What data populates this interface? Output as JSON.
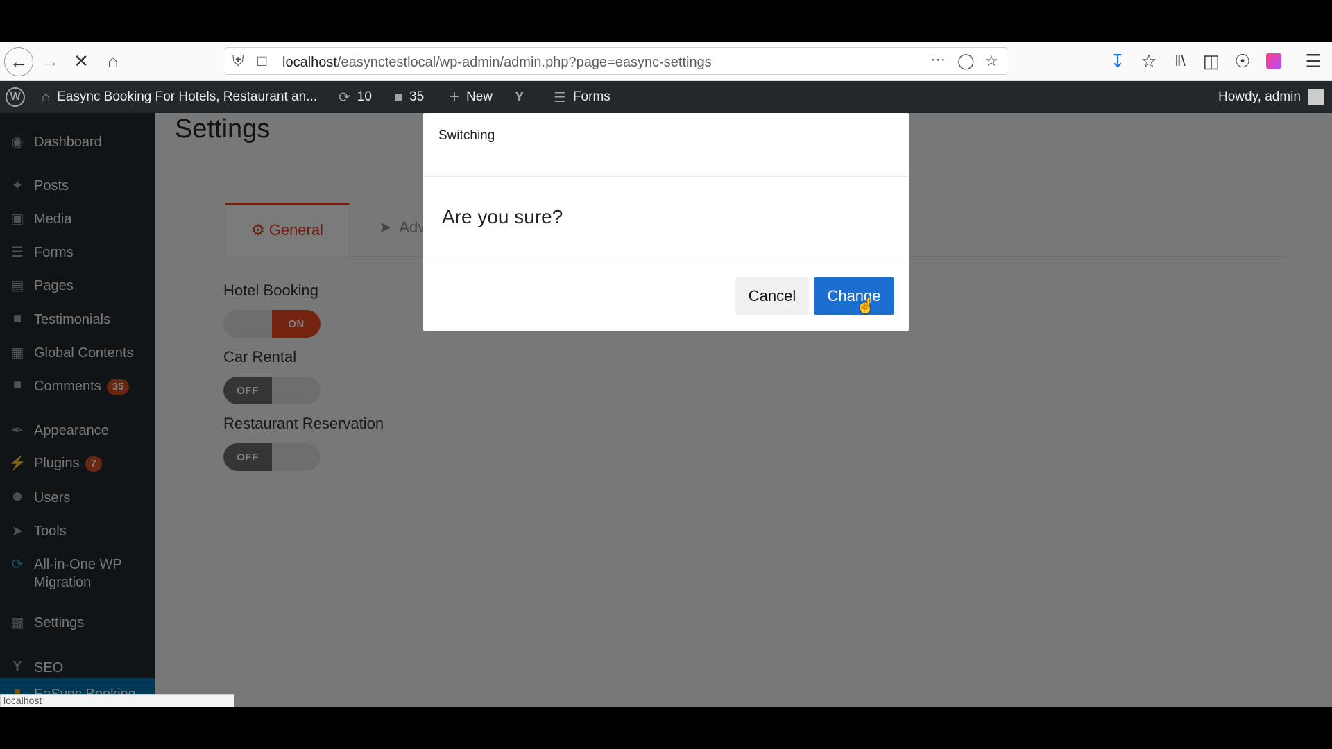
{
  "browser": {
    "url_host": "localhost",
    "url_path": "/easynctestlocal/wp-admin/admin.php?page=easync-settings"
  },
  "admin_bar": {
    "site_name": "Easync Booking For Hotels, Restaurant an...",
    "updates_count": "10",
    "comments_count": "35",
    "new_label": "New",
    "forms_label": "Forms",
    "howdy": "Howdy, admin"
  },
  "sidebar": {
    "items": [
      {
        "label": "Dashboard",
        "icon": "dashboard-icon"
      },
      {
        "label": "Posts",
        "icon": "pin-icon"
      },
      {
        "label": "Media",
        "icon": "media-icon"
      },
      {
        "label": "Forms",
        "icon": "forms-icon"
      },
      {
        "label": "Pages",
        "icon": "pages-icon"
      },
      {
        "label": "Testimonials",
        "icon": "testimonial-icon"
      },
      {
        "label": "Global Contents",
        "icon": "grid-icon"
      },
      {
        "label": "Comments",
        "icon": "comment-icon",
        "badge": "35"
      },
      {
        "label": "Appearance",
        "icon": "brush-icon"
      },
      {
        "label": "Plugins",
        "icon": "plug-icon",
        "badge": "7"
      },
      {
        "label": "Users",
        "icon": "user-icon"
      },
      {
        "label": "Tools",
        "icon": "wrench-icon"
      },
      {
        "label": "All-in-One WP",
        "label2": "Migration",
        "icon": "migration-icon"
      },
      {
        "label": "Settings",
        "icon": "settings-icon"
      },
      {
        "label": "SEO",
        "icon": "yoast-icon"
      },
      {
        "label": "EaSync Booking",
        "icon": "booking-icon"
      }
    ]
  },
  "page": {
    "title": "Settings",
    "tab_general": "General",
    "tab_advanced": "Adv",
    "options": [
      {
        "label": "Hotel Booking",
        "state": "ON"
      },
      {
        "label": "Car Rental",
        "state": "OFF"
      },
      {
        "label": "Restaurant Reservation",
        "state": "OFF"
      }
    ]
  },
  "modal": {
    "title": "Switching",
    "question": "Are you sure?",
    "cancel": "Cancel",
    "confirm": "Change"
  },
  "status_bar": "localhost"
}
